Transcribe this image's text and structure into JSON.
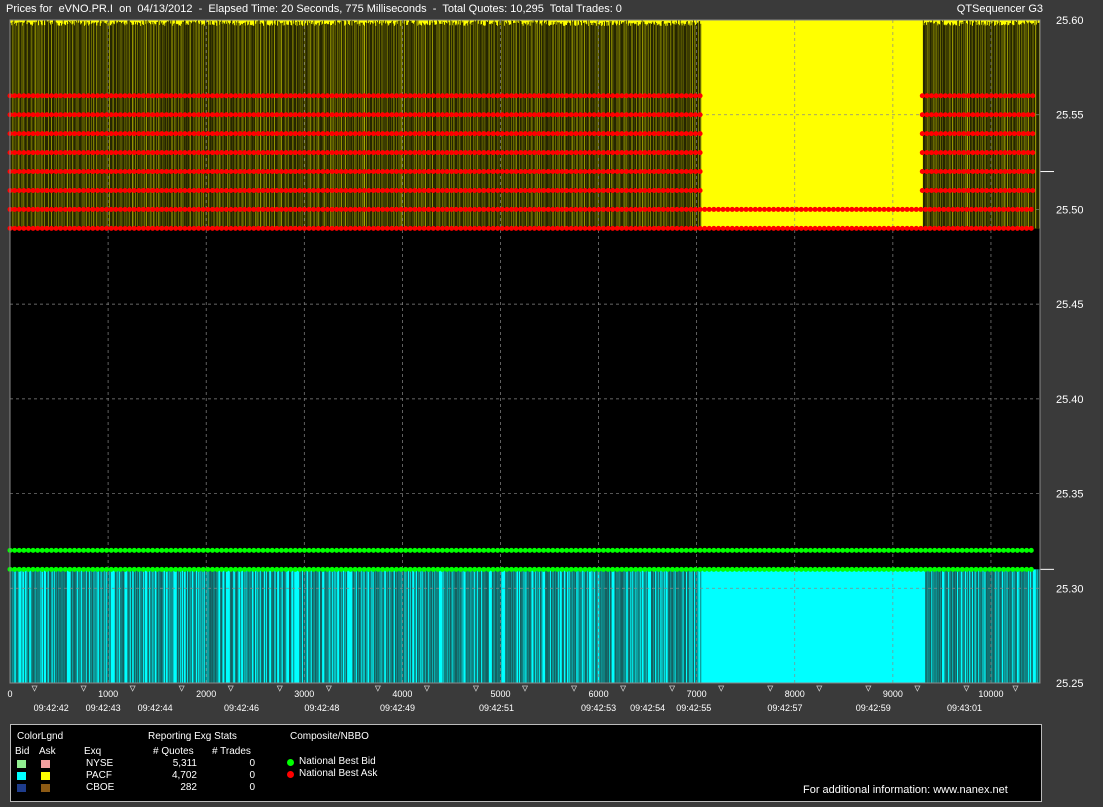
{
  "header": {
    "title": "Prices for  eVNO.PR.I  on  04/13/2012  -  Elapsed Time: 20 Seconds, 775 Milliseconds  -  Total Quotes: 10,295  Total Trades: 0",
    "app": "QTSequencer G3"
  },
  "chart_data": {
    "type": "line",
    "xlim": [
      0,
      10500
    ],
    "ylim": [
      25.25,
      25.6
    ],
    "y_ticks": [
      "25.25",
      "25.30",
      "25.35",
      "25.40",
      "25.45",
      "25.50",
      "25.55",
      "25.60"
    ],
    "x_ticks": [
      "0",
      "1000",
      "2000",
      "3000",
      "4000",
      "5000",
      "6000",
      "7000",
      "8000",
      "9000",
      "10000"
    ],
    "time_labels": [
      {
        "x": 420,
        "label": "09:42:42"
      },
      {
        "x": 950,
        "label": "09:42:43"
      },
      {
        "x": 1480,
        "label": "09:42:44"
      },
      {
        "x": 2360,
        "label": "09:42:46"
      },
      {
        "x": 3180,
        "label": "09:42:48"
      },
      {
        "x": 3950,
        "label": "09:42:49"
      },
      {
        "x": 4960,
        "label": "09:42:51"
      },
      {
        "x": 6000,
        "label": "09:42:53"
      },
      {
        "x": 6500,
        "label": "09:42:54"
      },
      {
        "x": 6970,
        "label": "09:42:55"
      },
      {
        "x": 7900,
        "label": "09:42:57"
      },
      {
        "x": 8800,
        "label": "09:42:59"
      },
      {
        "x": 9730,
        "label": "09:43:01"
      }
    ],
    "series": [
      {
        "name": "National Best Bid",
        "color": "#00ff00",
        "levels": [
          {
            "y": 25.32,
            "x": [
              0,
              10500
            ]
          },
          {
            "y": 25.31,
            "x": [
              0,
              10500
            ]
          }
        ]
      },
      {
        "name": "National Best Ask",
        "color": "#ff0000",
        "levels": [
          {
            "y": 25.56,
            "x": [
              0,
              7050
            ],
            "x2": [
              9300,
              10500
            ]
          },
          {
            "y": 25.55,
            "x": [
              0,
              7050
            ],
            "x2": [
              9300,
              10500
            ]
          },
          {
            "y": 25.54,
            "x": [
              0,
              7050
            ],
            "x2": [
              9300,
              10500
            ]
          },
          {
            "y": 25.53,
            "x": [
              0,
              7050
            ],
            "x2": [
              9300,
              10500
            ]
          },
          {
            "y": 25.52,
            "x": [
              0,
              7050
            ],
            "x2": [
              9300,
              10500
            ]
          },
          {
            "y": 25.51,
            "x": [
              0,
              7050
            ],
            "x2": [
              9300,
              10500
            ]
          },
          {
            "y": 25.5,
            "x": [
              0,
              10500
            ]
          },
          {
            "y": 25.49,
            "x": [
              0,
              10500
            ]
          }
        ]
      }
    ],
    "ask_band": {
      "exchange": "PACF",
      "color": "#ffff00",
      "low": 25.49,
      "high": 25.6
    },
    "bid_band": {
      "exchange": "PACF",
      "color": "#00ffff",
      "low": 25.25,
      "high": 25.31
    },
    "solid_region": [
      7050,
      9300
    ],
    "vertical_line_color": "#000000",
    "bid_line_color": "#1a3a3a",
    "grid": true,
    "current_bid": 25.31,
    "current_ask": 25.52
  },
  "legend": {
    "title": "ColorLgnd",
    "bid_header": "Bid",
    "ask_header": "Ask",
    "exq_header": "Exq",
    "stats_title": "Reporting Exg Stats",
    "quotes_header": "# Quotes",
    "trades_header": "# Trades",
    "composite_title": "Composite/NBBO",
    "rows": [
      {
        "exchange": "NYSE",
        "quotes": "5,311",
        "trades": "0",
        "bid_color": "#90ee90",
        "ask_color": "#f4a0a0"
      },
      {
        "exchange": "PACF",
        "quotes": "4,702",
        "trades": "0",
        "bid_color": "#00ffff",
        "ask_color": "#ffff00"
      },
      {
        "exchange": "CBOE",
        "quotes": "282",
        "trades": "0",
        "bid_color": "#1e3c8c",
        "ask_color": "#8c5a14"
      }
    ],
    "nbbo": [
      {
        "label": "National Best Bid",
        "color": "#00ff00"
      },
      {
        "label": "National Best Ask",
        "color": "#ff0000"
      }
    ],
    "footer": "For additional information: www.nanex.net"
  }
}
